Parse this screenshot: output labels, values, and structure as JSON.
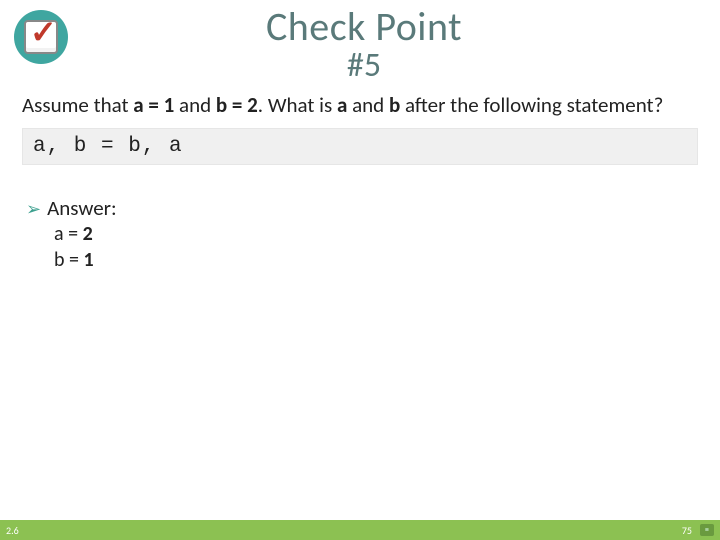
{
  "title": {
    "line1": "Check Point",
    "line2": "#5"
  },
  "badge": {
    "icon": "check-icon"
  },
  "question": {
    "prefix": "Assume that ",
    "assume1": "a = 1",
    "mid1": " and ",
    "assume2": "b = 2",
    "mid2": ". What is ",
    "var1": "a",
    "mid3": " and ",
    "var2": "b",
    "suffix": " after the following statement?"
  },
  "code": "a, b = b, a",
  "answer": {
    "label": "Answer:",
    "line1_pre": "a = ",
    "line1_val": "2",
    "line2_pre": "b = ",
    "line2_val": "1"
  },
  "footer": {
    "left": "2.6",
    "page": "75"
  }
}
